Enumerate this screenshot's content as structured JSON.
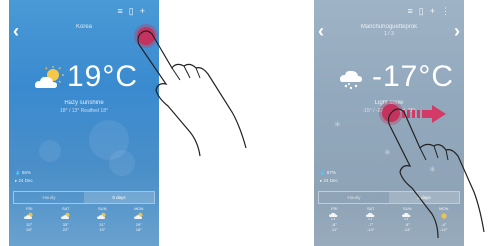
{
  "left_phone": {
    "city": "Korea",
    "temperature": "19°C",
    "description": "Hazy sunshine",
    "description_sub": "18° / 13° Realfeel 18°",
    "meta": [
      "56%",
      "24 Dec"
    ],
    "tabs": [
      "Hourly",
      "5 days"
    ],
    "active_tab": 1,
    "forecast": [
      {
        "day": "FRI",
        "hi": "32°",
        "lo": "26°",
        "icon": "sun-cloud-icon"
      },
      {
        "day": "SAT",
        "hi": "33°",
        "lo": "22°",
        "icon": "sun-cloud-icon"
      },
      {
        "day": "SUN",
        "hi": "31°",
        "lo": "19°",
        "icon": "sun-cloud-icon"
      },
      {
        "day": "MON",
        "hi": "29°",
        "lo": "18°",
        "icon": "sun-cloud-icon"
      }
    ]
  },
  "right_phone": {
    "city": "Manchuhoguetteprok",
    "city_sub": "1 / 3",
    "temperature": "-17°C",
    "description": "Light snow",
    "description_sub": "-15° / -22° Realfeel -25°",
    "meta": [
      "87%",
      "24 Dec"
    ],
    "tabs": [
      "Hourly",
      "5 days"
    ],
    "active_tab": 1,
    "forecast": [
      {
        "day": "FRI",
        "hi": "-8°",
        "lo": "-11°",
        "icon": "snow-cloud-icon"
      },
      {
        "day": "SAT",
        "hi": "-7°",
        "lo": "-14°",
        "icon": "snow-cloud-icon"
      },
      {
        "day": "SUN",
        "hi": "-9°",
        "lo": "-14°",
        "icon": "snow-cloud-icon"
      },
      {
        "day": "MON",
        "hi": "-4°",
        "lo": "-12°",
        "icon": "sun-icon"
      }
    ]
  },
  "toolbar_icons": [
    "menu-icon",
    "trash-icon",
    "plus-icon",
    "more-icon"
  ],
  "colors": {
    "tap_accent": "#c4325e",
    "left_bg": "#3a8ad0",
    "right_bg": "#92a8bc"
  }
}
